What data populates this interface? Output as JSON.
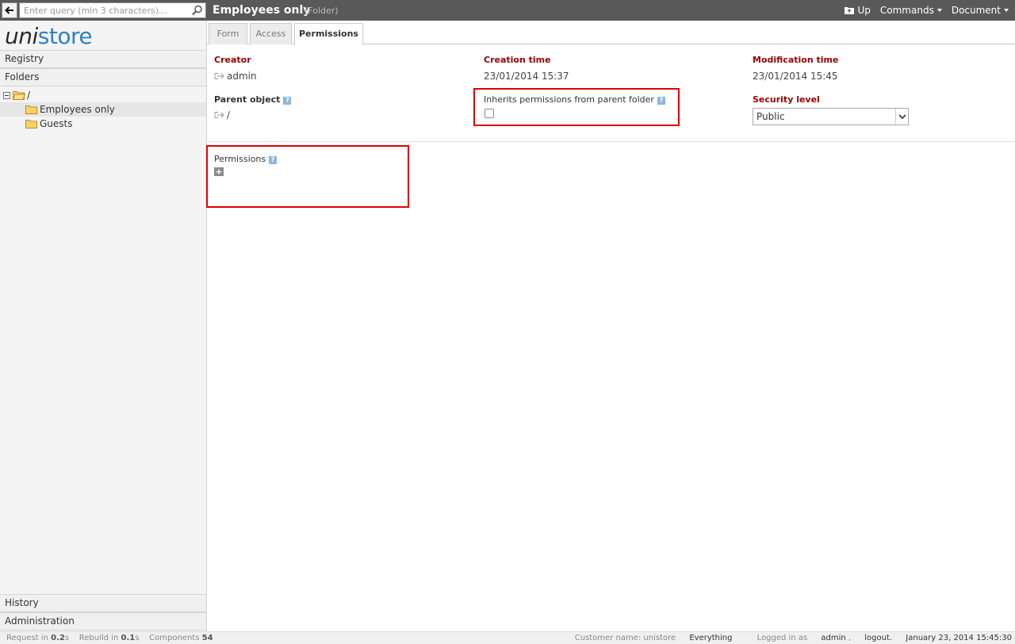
{
  "topbar": {
    "search_placeholder": "Enter query (min 3 characters)...",
    "title": "Employees only",
    "type": "(Folder)",
    "nav": {
      "up": "Up",
      "commands": "Commands",
      "document": "Document"
    }
  },
  "sidebar": {
    "logo_part1": "uni",
    "logo_part2": "store",
    "registry": "Registry",
    "folders": "Folders",
    "tree": {
      "root": "/",
      "items": [
        "Employees only",
        "Guests"
      ]
    },
    "history": "History",
    "administration": "Administration"
  },
  "tabs": {
    "form": "Form",
    "access": "Access",
    "permissions": "Permissions"
  },
  "fields": {
    "creator_label": "Creator",
    "creator_value": "admin",
    "creation_time_label": "Creation time",
    "creation_time_value": "23/01/2014 15:37",
    "modification_time_label": "Modification time",
    "modification_time_value": "23/01/2014 15:45",
    "parent_object_label": "Parent object",
    "parent_object_value": "/",
    "inherits_label": "Inherits permissions from parent folder",
    "security_level_label": "Security level",
    "security_level_value": "Public",
    "permissions_label": "Permissions",
    "help_glyph": "?",
    "add_glyph": "+"
  },
  "status": {
    "request_label": "Request in",
    "request_value": "0.2",
    "rebuild_label": "Rebuild in",
    "rebuild_value": "0.1",
    "unit": "s",
    "components_label": "Components",
    "components_value": "54",
    "customer": "Customer name: unistore",
    "everything": "Everything",
    "logged_label": "Logged in as",
    "user": "admin",
    "logout": "logout.",
    "datetime": "January 23, 2014 15:45:30"
  }
}
